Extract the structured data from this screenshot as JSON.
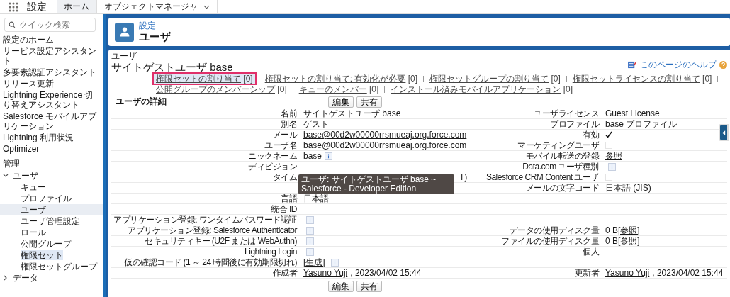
{
  "top_nav": {
    "app_title": "設定",
    "tabs": [
      {
        "label": "ホーム",
        "selected": true,
        "has_menu": false
      },
      {
        "label": "オブジェクトマネージャ",
        "selected": false,
        "has_menu": true
      }
    ]
  },
  "sidebar": {
    "search": {
      "placeholder": "クイック検索"
    },
    "items": [
      {
        "kind": "link",
        "label": "設定のホーム",
        "selected": false
      },
      {
        "kind": "link",
        "label": "サービス設定アシスタント",
        "selected": false
      },
      {
        "kind": "link",
        "label": "多要素認証アシスタント",
        "selected": false
      },
      {
        "kind": "link",
        "label": "リリース更新",
        "selected": false
      },
      {
        "kind": "link",
        "label": "Lightning Experience 切り替えアシスタント",
        "selected": false
      },
      {
        "kind": "link",
        "label": "Salesforce モバイルアプリケーション",
        "selected": false
      },
      {
        "kind": "link",
        "label": "Lightning 利用状況",
        "selected": false
      },
      {
        "kind": "link",
        "label": "Optimizer",
        "selected": false
      },
      {
        "kind": "heading",
        "label": "管理"
      },
      {
        "kind": "folder",
        "label": "ユーザ",
        "expanded": true,
        "children": [
          {
            "label": "キュー",
            "selected": false,
            "highlighted": false
          },
          {
            "label": "プロファイル",
            "selected": false,
            "highlighted": false
          },
          {
            "label": "ユーザ",
            "selected": true,
            "highlighted": false
          },
          {
            "label": "ユーザ管理設定",
            "selected": false,
            "highlighted": false
          },
          {
            "label": "ロール",
            "selected": false,
            "highlighted": false
          },
          {
            "label": "公開グループ",
            "selected": false,
            "highlighted": false
          },
          {
            "label": "権限セット",
            "selected": false,
            "highlighted": true
          },
          {
            "label": "権限セットグループ",
            "selected": false,
            "highlighted": false
          }
        ]
      },
      {
        "kind": "folder",
        "label": "データ",
        "expanded": false
      }
    ]
  },
  "page_header": {
    "breadcrumb": "設定",
    "title": "ユーザ"
  },
  "detail": {
    "object_label": "ユーザ",
    "title": "サイトゲストユーザ base",
    "help_link": "このページのヘルプ",
    "related_links": [
      {
        "label": "権限セットの割り当て",
        "count": "[0]",
        "highlighted": true
      },
      {
        "label": "権限セットの割り当て: 有効化が必要",
        "count": "[0]",
        "highlighted": false
      },
      {
        "label": "権限セットグループの割り当て",
        "count": "[0]",
        "highlighted": false
      },
      {
        "label": "権限セットライセンスの割り当て",
        "count": "[0]",
        "highlighted": false
      },
      {
        "label": "公開グループのメンバーシップ",
        "count": "[0]",
        "highlighted": false
      },
      {
        "label": "キューのメンバー",
        "count": "[0]",
        "highlighted": false
      },
      {
        "label": "インストール済みモバイルアプリケーション",
        "count": "[0]",
        "highlighted": false
      }
    ],
    "section_title": "ユーザの詳細",
    "buttons": [
      "編集",
      "共有"
    ],
    "bottom_buttons": [
      "編集",
      "共有"
    ],
    "tooltip": "ユーザ: サイトゲストユーザ base ~ Salesforce - Developer Edition",
    "rows": [
      {
        "left": {
          "label": "名前",
          "value": [
            {
              "kind": "text",
              "text": "サイトゲストユーザ base"
            }
          ]
        },
        "right": {
          "label": "ユーザライセンス",
          "value": [
            {
              "kind": "text",
              "text": "Guest License"
            }
          ]
        }
      },
      {
        "left": {
          "label": "別名",
          "value": [
            {
              "kind": "text",
              "text": "ゲスト"
            }
          ]
        },
        "right": {
          "label": "プロファイル",
          "value": [
            {
              "kind": "link",
              "text": "base プロファイル"
            }
          ]
        }
      },
      {
        "left": {
          "label": "メール",
          "value": [
            {
              "kind": "link",
              "text": "base@00d2w00000rrsmueaj.org.force.com"
            }
          ]
        },
        "right": {
          "label": "有効",
          "value": [
            {
              "kind": "checkbox",
              "checked": true
            }
          ]
        }
      },
      {
        "left": {
          "label": "ユーザ名",
          "value": [
            {
              "kind": "text",
              "text": "base@00d2w00000rrsmueaj.org.force.com"
            }
          ]
        },
        "right": {
          "label": "マーケティングユーザ",
          "value": [
            {
              "kind": "checkbox",
              "checked": false
            }
          ]
        }
      },
      {
        "left": {
          "label": "ニックネーム",
          "value": [
            {
              "kind": "text",
              "text": "base"
            },
            {
              "kind": "info"
            }
          ]
        },
        "right": {
          "label": "モバイル転送の登録",
          "value": [
            {
              "kind": "link",
              "text": "参照"
            }
          ]
        }
      },
      {
        "left": {
          "label": "ディビジョン"
        },
        "right": {
          "label": "Data.com ユーザ種別",
          "value": [
            {
              "kind": "info"
            }
          ]
        }
      },
      {
        "left": {
          "label": "タイム",
          "value": [
            {
              "kind": "covered_text",
              "text": "T)"
            }
          ]
        },
        "right": {
          "label": "Salesforce CRM Content ユーザ",
          "value": [
            {
              "kind": "checkbox",
              "checked": false
            }
          ]
        }
      },
      {
        "left": {},
        "right": {
          "label": "メールの文字コード",
          "value": [
            {
              "kind": "text",
              "text": "日本語 (JIS)"
            }
          ]
        }
      },
      {
        "left": {
          "label": "言語",
          "value": [
            {
              "kind": "text",
              "text": "日本語"
            }
          ]
        },
        "right": {}
      },
      {
        "left": {
          "label": "統合 ID"
        },
        "right": {}
      },
      {
        "left": {
          "label": "アプリケーション登録: ワンタイムパスワード認証",
          "value": [
            {
              "kind": "info"
            }
          ]
        },
        "right": {}
      },
      {
        "left": {
          "label": "アプリケーション登録: Salesforce Authenticator",
          "value": [
            {
              "kind": "info"
            }
          ]
        },
        "right": {
          "label": "データの使用ディスク量",
          "value": [
            {
              "kind": "text",
              "text": "0 B"
            },
            {
              "kind": "link",
              "text": "[参照]"
            }
          ]
        }
      },
      {
        "left": {
          "label": "セキュリティキー (U2F または WebAuthn)",
          "value": [
            {
              "kind": "info"
            }
          ]
        },
        "right": {
          "label": "ファイルの使用ディスク量",
          "value": [
            {
              "kind": "text",
              "text": "0 B"
            },
            {
              "kind": "link",
              "text": "[参照]"
            }
          ]
        }
      },
      {
        "left": {
          "label": "Lightning Login",
          "value": [
            {
              "kind": "info"
            }
          ]
        },
        "right": {
          "label": "個人"
        }
      },
      {
        "left": {
          "label": "仮の確認コード (1 ～ 24 時間後に有効期限切れ)",
          "value": [
            {
              "kind": "link",
              "text": "[生成]"
            },
            {
              "kind": "info"
            }
          ]
        },
        "right": {}
      },
      {
        "left": {
          "label": "作成者",
          "value": [
            {
              "kind": "link",
              "text": "Yasuno Yuji"
            },
            {
              "kind": "text",
              "text": ", 2023/04/02 15:44"
            }
          ]
        },
        "right": {
          "label": "更新者",
          "value": [
            {
              "kind": "link",
              "text": "Yasuno Yuji"
            },
            {
              "kind": "text",
              "text": ", 2023/04/02 15:44"
            }
          ]
        }
      }
    ]
  }
}
